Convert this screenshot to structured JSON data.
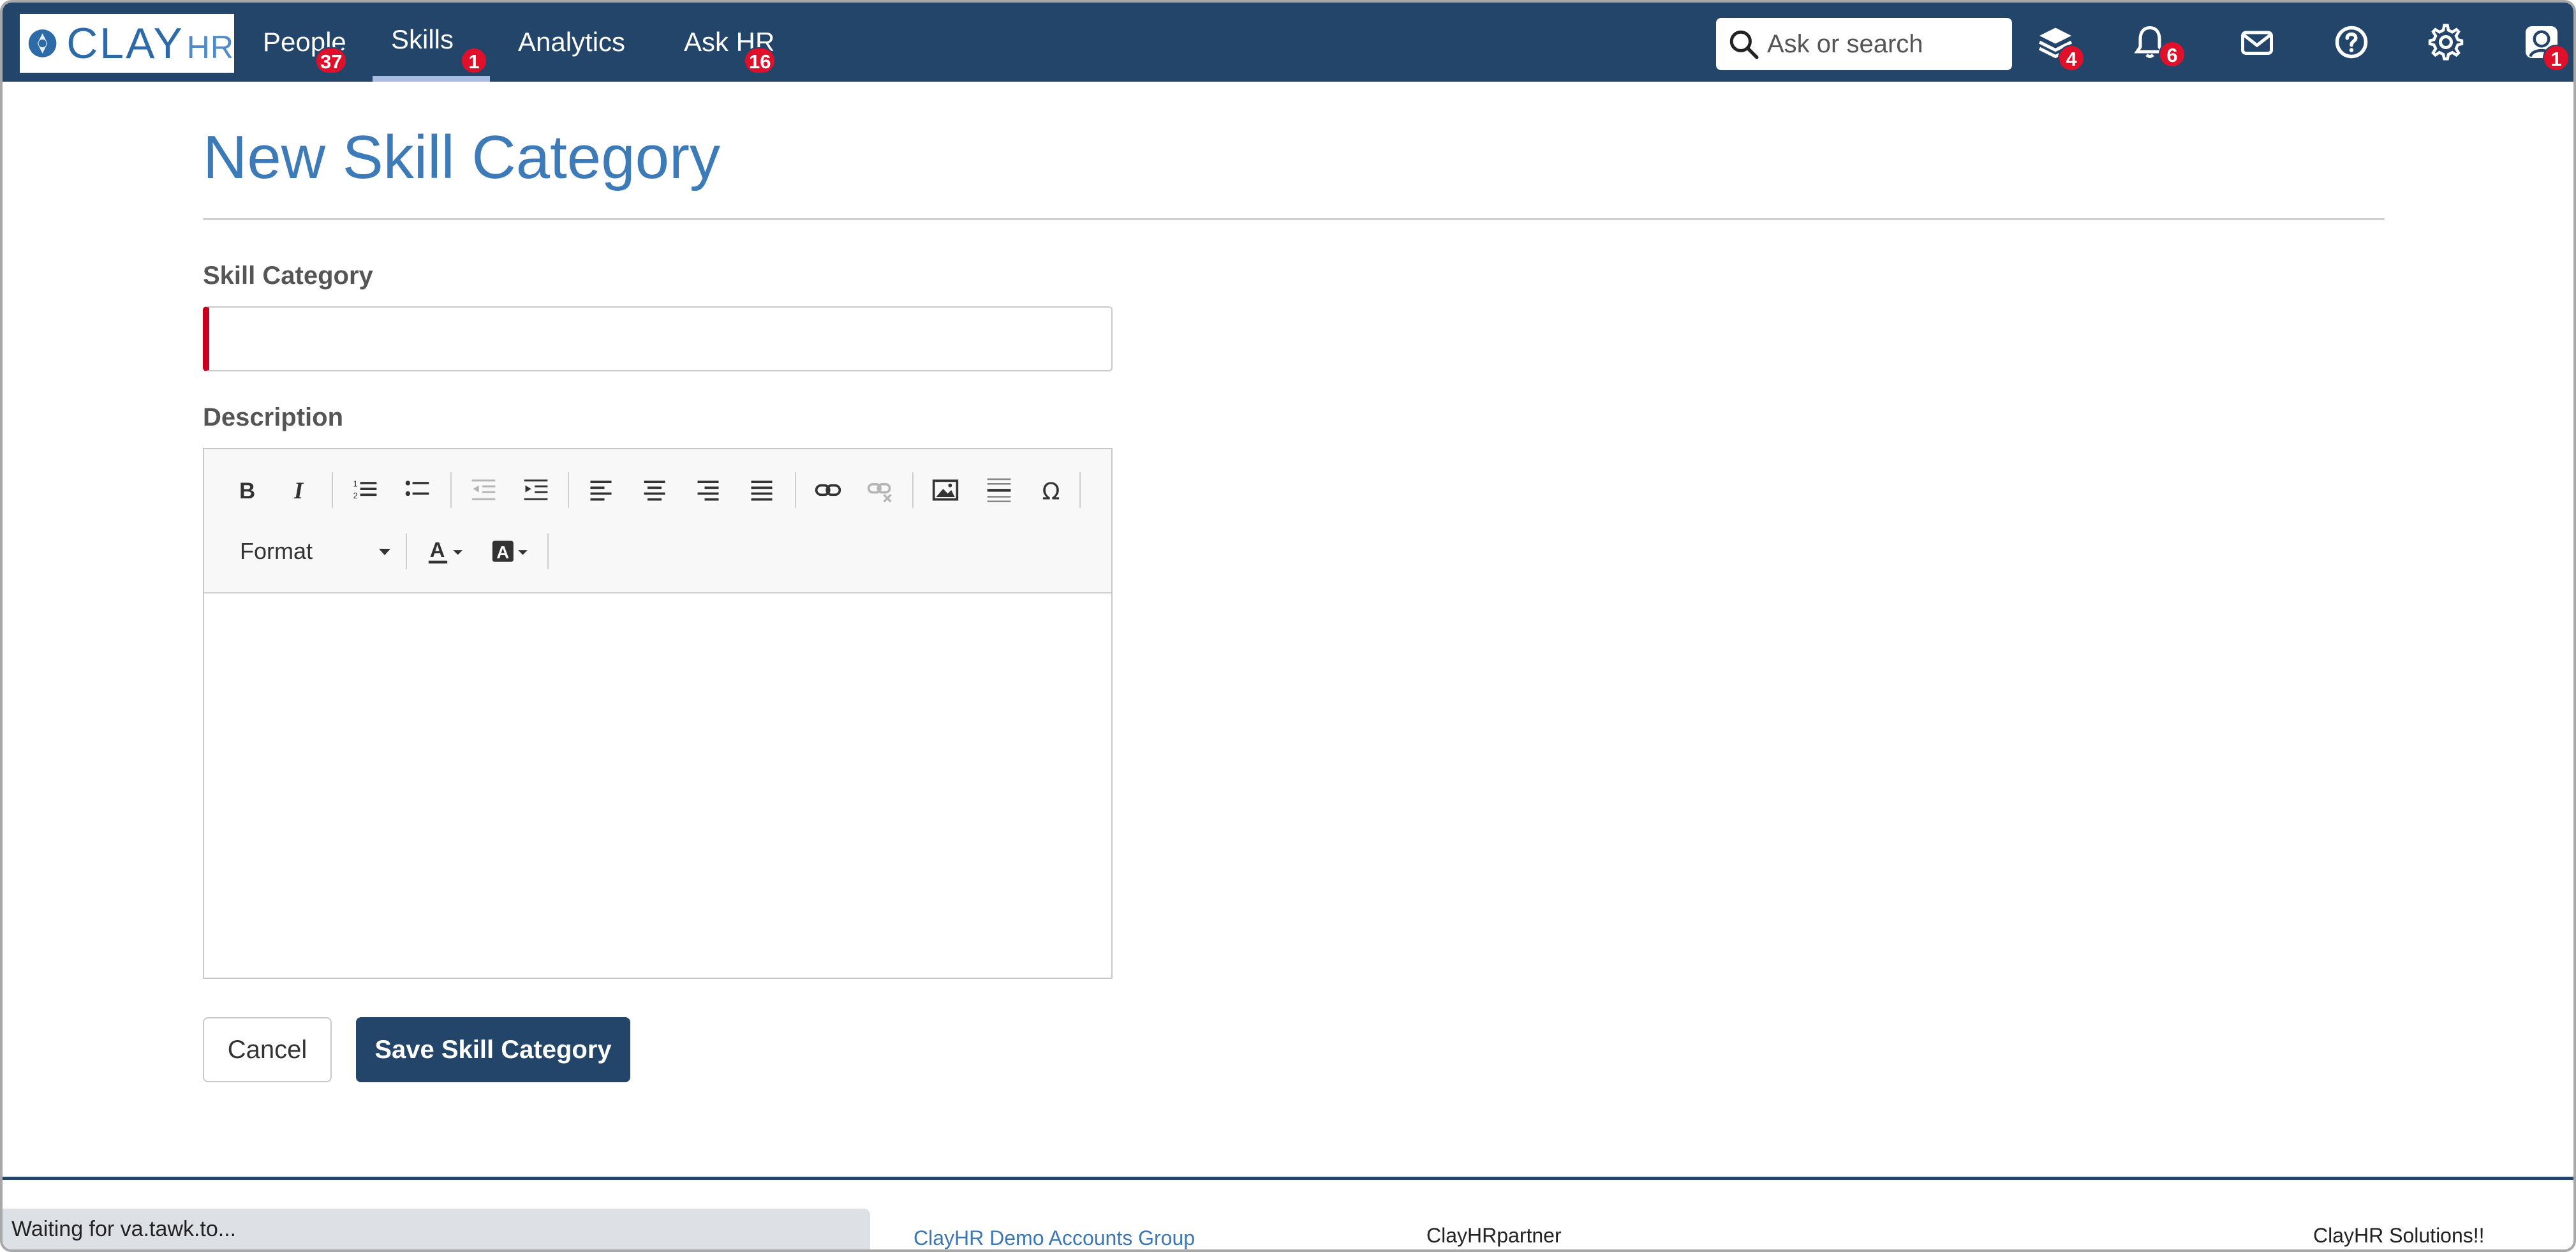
{
  "app": {
    "logo_text": "CLAY",
    "logo_suffix": "HR"
  },
  "nav": {
    "items": [
      {
        "label": "People",
        "badge": "37"
      },
      {
        "label": "Skills",
        "badge": "1",
        "active": true
      },
      {
        "label": "Analytics"
      },
      {
        "label": "Ask HR",
        "badge": "16"
      }
    ]
  },
  "search": {
    "placeholder": "Ask or search"
  },
  "top_icons": {
    "stack_badge": "4",
    "bell_badge": "6",
    "profile_badge": "1",
    "icon_names": [
      "layers-icon",
      "bell-icon",
      "mail-icon",
      "help-icon",
      "gear-icon",
      "profile-icon"
    ]
  },
  "page": {
    "title": "New Skill Category"
  },
  "form": {
    "skill_category_label": "Skill Category",
    "skill_category_value": "",
    "description_label": "Description",
    "format_label": "Format",
    "description_value": ""
  },
  "actions": {
    "cancel_label": "Cancel",
    "save_label": "Save Skill Category"
  },
  "footer": {
    "status_text": "Waiting for va.tawk.to...",
    "group_link": "ClayHR Demo Accounts Group",
    "partner_text": "ClayHRpartner",
    "company_text": "ClayHR Solutions!!"
  },
  "colors": {
    "nav_bg": "#24456a",
    "accent_blue": "#3d7ab8",
    "badge_red": "#e0102a",
    "required_red": "#c8001e",
    "active_underline": "#a9bde3"
  }
}
